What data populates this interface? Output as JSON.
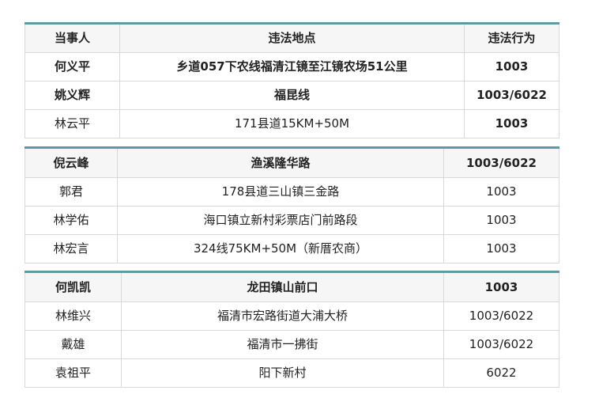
{
  "header": {
    "party": "当事人",
    "location": "违法地点",
    "behavior": "违法行为"
  },
  "block1": [
    {
      "party": "何义平",
      "location": "乡道057下农线福清江镜至江镜农场51公里",
      "behavior": "1003"
    },
    {
      "party": "姚义辉",
      "location": "福昆线",
      "behavior": "1003/6022"
    },
    {
      "party": "林云平",
      "location": "171县道15KM+50M",
      "behavior": "1003"
    }
  ],
  "block2": [
    {
      "party": "倪云峰",
      "location": "渔溪隆华路",
      "behavior": "1003/6022"
    },
    {
      "party": "郭君",
      "location": "178县道三山镇三金路",
      "behavior": "1003"
    },
    {
      "party": "林学佑",
      "location": "海口镇立新村彩票店门前路段",
      "behavior": "1003"
    },
    {
      "party": "林宏言",
      "location": "324线75KM+50M（新厝农商）",
      "behavior": "1003"
    }
  ],
  "block3": [
    {
      "party": "何凯凯",
      "location": "龙田镇山前口",
      "behavior": "1003"
    },
    {
      "party": "林维兴",
      "location": "福清市宏路街道大浦大桥",
      "behavior": "1003/6022"
    },
    {
      "party": "戴雄",
      "location": "福清市一拂街",
      "behavior": "1003/6022"
    },
    {
      "party": "袁祖平",
      "location": "阳下新村",
      "behavior": "6022"
    }
  ]
}
